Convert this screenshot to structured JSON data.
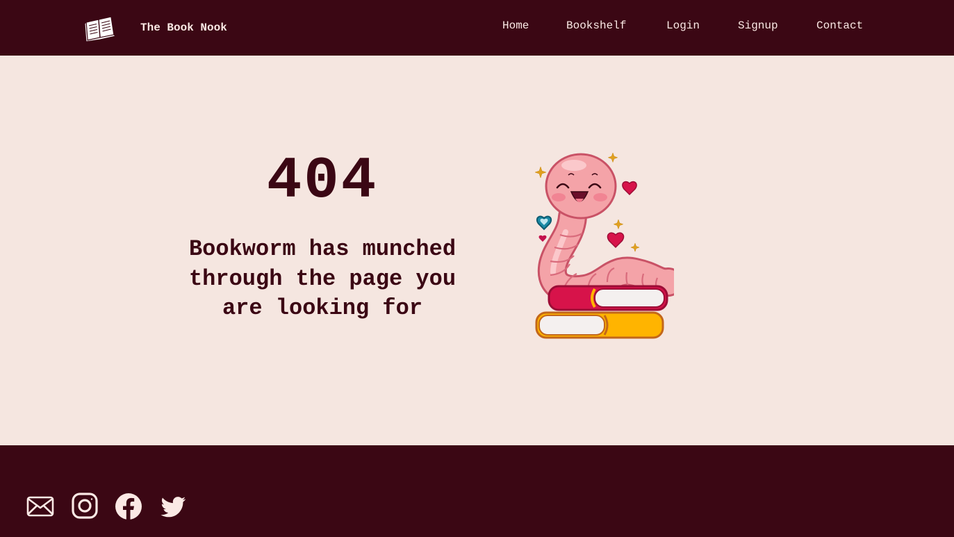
{
  "header": {
    "brand_name": "The Book Nook",
    "logo_icon": "open-book-icon",
    "nav": [
      {
        "label": "Home"
      },
      {
        "label": "Bookshelf"
      },
      {
        "label": "Login"
      },
      {
        "label": "Signup"
      },
      {
        "label": "Contact"
      }
    ]
  },
  "main": {
    "error_code": "404",
    "message": "Bookworm has munched through the page you are looking for",
    "illustration_icon": "bookworm-on-books-illustration"
  },
  "footer": {
    "social": [
      {
        "icon": "mail-icon"
      },
      {
        "icon": "instagram-icon"
      },
      {
        "icon": "facebook-icon"
      },
      {
        "icon": "twitter-icon"
      }
    ]
  },
  "colors": {
    "dark_maroon": "#3b0714",
    "cream_background": "#f5e6e0",
    "light_text": "#fbe9e5",
    "worm_pink": "#f4a3a8",
    "book_red": "#d7134a",
    "book_yellow": "#ffb400"
  }
}
